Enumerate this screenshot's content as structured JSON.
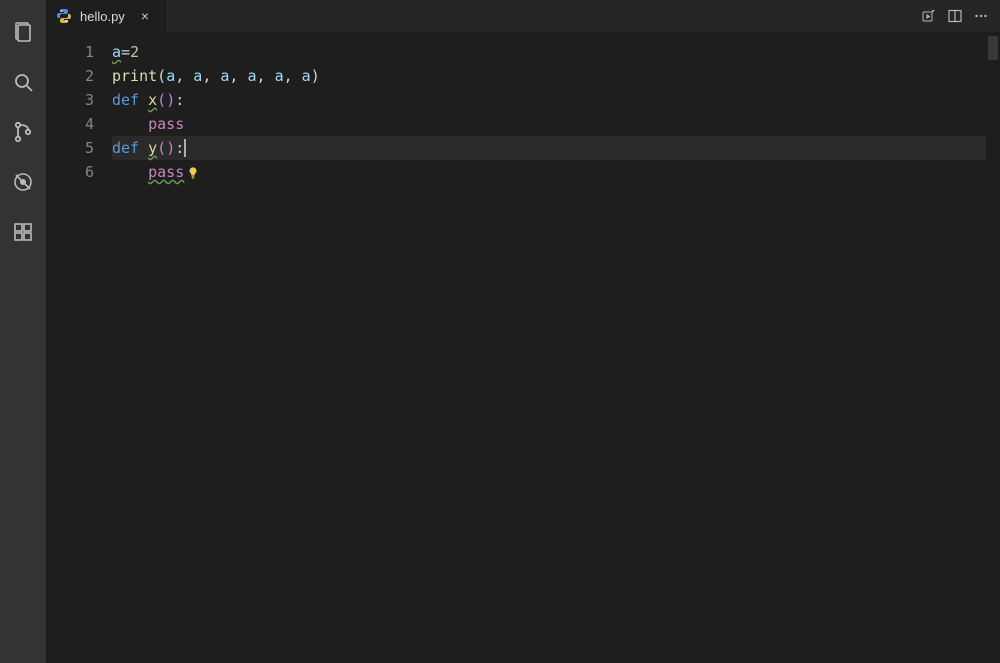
{
  "tabs": [
    {
      "filename": "hello.py",
      "active": true,
      "dirty": false
    }
  ],
  "editor": {
    "language": "python",
    "active_line": 5,
    "lines": [
      {
        "num": "1",
        "raw": "a=2",
        "tokens": [
          {
            "t": "a",
            "cls": "tok-var squig-g"
          },
          {
            "t": "=",
            "cls": "tok-op"
          },
          {
            "t": "2",
            "cls": "tok-num"
          }
        ]
      },
      {
        "num": "2",
        "raw": "print(a, a, a, a, a, a)",
        "tokens": [
          {
            "t": "print",
            "cls": "tok-func"
          },
          {
            "t": "(",
            "cls": "tok-paren"
          },
          {
            "t": "a",
            "cls": "tok-var"
          },
          {
            "t": ", ",
            "cls": "tok-plain"
          },
          {
            "t": "a",
            "cls": "tok-var"
          },
          {
            "t": ", ",
            "cls": "tok-plain"
          },
          {
            "t": "a",
            "cls": "tok-var"
          },
          {
            "t": ", ",
            "cls": "tok-plain"
          },
          {
            "t": "a",
            "cls": "tok-var"
          },
          {
            "t": ", ",
            "cls": "tok-plain"
          },
          {
            "t": "a",
            "cls": "tok-var"
          },
          {
            "t": ", ",
            "cls": "tok-plain"
          },
          {
            "t": "a",
            "cls": "tok-var"
          },
          {
            "t": ")",
            "cls": "tok-paren"
          }
        ]
      },
      {
        "num": "3",
        "raw": "def x():",
        "tokens": [
          {
            "t": "def",
            "cls": "tok-def"
          },
          {
            "t": " ",
            "cls": "tok-plain"
          },
          {
            "t": "x",
            "cls": "tok-func squig-g"
          },
          {
            "t": "(",
            "cls": "tok-bparen"
          },
          {
            "t": ")",
            "cls": "tok-bparen"
          },
          {
            "t": ":",
            "cls": "tok-plain"
          }
        ]
      },
      {
        "num": "4",
        "raw": "    pass",
        "tokens": [
          {
            "t": "    ",
            "cls": "tok-plain"
          },
          {
            "t": "pass",
            "cls": "tok-pass"
          }
        ]
      },
      {
        "num": "5",
        "raw": "def y():",
        "current": true,
        "caret_after": true,
        "tokens": [
          {
            "t": "def",
            "cls": "tok-def"
          },
          {
            "t": " ",
            "cls": "tok-plain"
          },
          {
            "t": "y",
            "cls": "tok-func squig-g"
          },
          {
            "t": "(",
            "cls": "tok-pparen"
          },
          {
            "t": ")",
            "cls": "tok-pparen"
          },
          {
            "t": ":",
            "cls": "tok-plain"
          }
        ]
      },
      {
        "num": "6",
        "raw": "    pass",
        "lightbulb": true,
        "tokens": [
          {
            "t": "    ",
            "cls": "tok-plain"
          },
          {
            "t": "pass",
            "cls": "tok-pass squig-g"
          }
        ]
      }
    ]
  },
  "activity": {
    "items": [
      {
        "name": "explorer"
      },
      {
        "name": "search"
      },
      {
        "name": "source-control"
      },
      {
        "name": "debug"
      },
      {
        "name": "extensions"
      }
    ]
  },
  "tabbar_actions": {
    "run": "run-file",
    "split": "split-editor",
    "more": "more-actions"
  }
}
